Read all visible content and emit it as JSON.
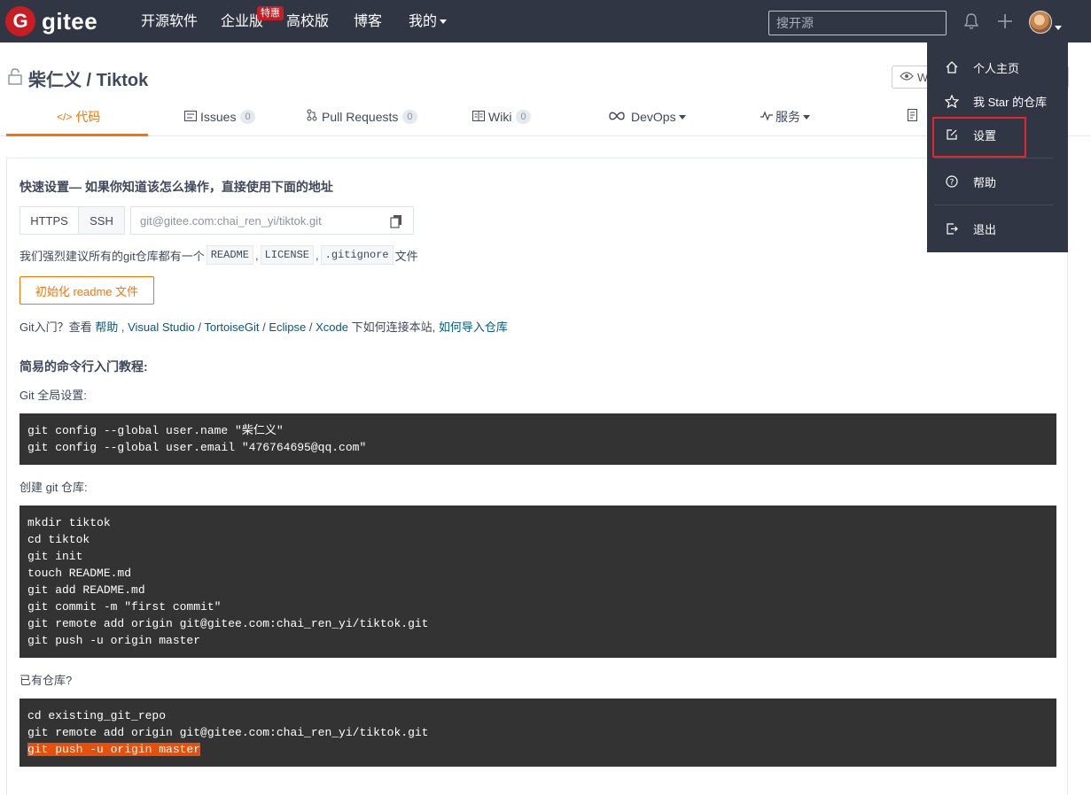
{
  "navbar": {
    "logo_mark": "G",
    "logo_text": "gitee",
    "items": [
      "开源软件",
      "企业版",
      "高校版",
      "博客",
      "我的"
    ],
    "badge": "特惠",
    "search_placeholder": "搜开源"
  },
  "repo": {
    "title": "柴仁义 / Tiktok",
    "watch_label": "Wa"
  },
  "tabs": [
    {
      "label": "代码",
      "count": null
    },
    {
      "label": "Issues",
      "count": "0"
    },
    {
      "label": "Pull Requests",
      "count": "0"
    },
    {
      "label": "Wiki",
      "count": "0"
    },
    {
      "label": "DevOps",
      "count": null
    },
    {
      "label": "服务",
      "count": null
    }
  ],
  "quick_setup": {
    "heading": "快速设置— 如果你知道该怎么操作，直接使用下面的地址",
    "https_label": "HTTPS",
    "ssh_label": "SSH",
    "url": "git@gitee.com:chai_ren_yi/tiktok.git",
    "recommend_prefix": "我们强烈建议所有的git仓库都有一个",
    "readme": "README",
    "license": "LICENSE",
    "gitignore": ".gitignore",
    "recommend_suffix": "文件",
    "comma": ",",
    "init_button": "初始化 readme 文件",
    "help_prefix": "Git入门？查看 ",
    "help_link": "帮助",
    "help_sep1": " , ",
    "tool1": "Visual Studio",
    "slash": " / ",
    "tool2": "TortoiseGit",
    "tool3": "Eclipse",
    "tool4": "Xcode",
    "help_mid": " 下如何连接本站, ",
    "import_link": "如何导入仓库"
  },
  "tutorial": {
    "heading": "简易的命令行入门教程:",
    "global_label": "Git 全局设置:",
    "global_lines": [
      "git config --global user.name \"柴仁义\"",
      "git config --global user.email \"476764695@qq.com\""
    ],
    "create_label": "创建 git 仓库:",
    "create_lines": [
      "mkdir tiktok",
      "cd tiktok",
      "git init",
      "touch README.md",
      "git add README.md",
      "git commit -m \"first commit\"",
      "git remote add origin git@gitee.com:chai_ren_yi/tiktok.git",
      "git push -u origin master"
    ],
    "existing_label": "已有仓库?",
    "existing_lines": [
      "cd existing_git_repo",
      "git remote add origin git@gitee.com:chai_ren_yi/tiktok.git"
    ],
    "existing_highlight": "git push -u origin master"
  },
  "dropdown": {
    "items": [
      "个人主页",
      "我 Star 的仓库",
      "设置",
      "帮助",
      "退出"
    ]
  },
  "colors": {
    "navbar": "#303643",
    "accent": "#fe7300",
    "brand": "#c71d23",
    "code_bg": "#333333",
    "highlight_box": "#e5262b"
  }
}
